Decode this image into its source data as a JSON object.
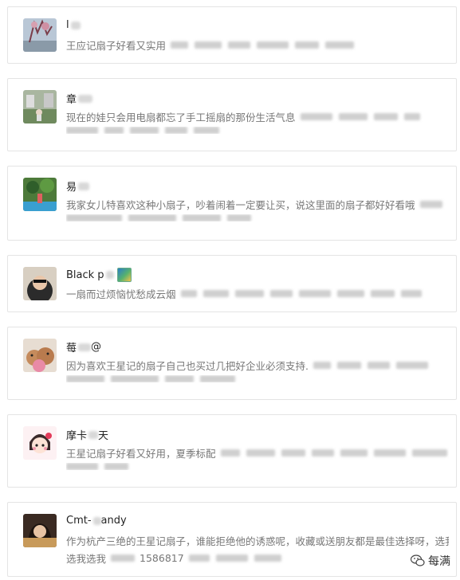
{
  "comments": [
    {
      "name": "l",
      "text": "王应记扇子好看又实用",
      "text2": ""
    },
    {
      "name": "章",
      "text": "现在的娃只会用电扇都忘了手工摇扇的那份生活气息",
      "text2": ""
    },
    {
      "name": "易",
      "text": "我家女儿特喜欢这种小扇子，吵着闹着一定要让买，说这里面的扇子都好好看哦",
      "text2": ""
    },
    {
      "name": "Black p",
      "text": "一扇而过烦恼忧愁成云烟",
      "text2": ""
    },
    {
      "name": "莓",
      "name_suffix": "@",
      "text": "因为喜欢王星记的扇子自己也买过几把好企业必须支持.",
      "text2": ""
    },
    {
      "name": "摩卡",
      "name_suffix": "天",
      "text": "王星记扇子好看又好用，夏季标配",
      "text2": ""
    },
    {
      "name": "Cmt-",
      "name_suffix": "andy",
      "text": "作为杭产三绝的王星记扇子，谁能拒绝他的诱惑呢，收藏或送朋友都是最佳选择呀，选我",
      "text2": "选我选我",
      "text2_suffix": "1586817"
    }
  ],
  "watermark": {
    "label": "每满",
    "icon": "wechat-icon"
  }
}
